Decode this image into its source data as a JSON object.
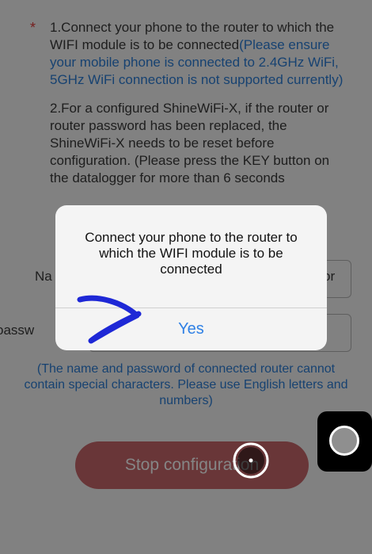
{
  "instructions": {
    "step1_asterisk": "*",
    "step1_text": "1.Connect your phone to the router to which the WIFI module is to be connected",
    "step1_note": "(Please ensure your mobile phone is connected to 2.4GHz WiFi, 5GHz WiFi connection is not supported currently)",
    "step2_text": "2.For a configured ShineWiFi-X, if the router or router password has been replaced, the ShineWiFi-X needs to be reset before configuration. (Please press the KEY button on the datalogger for more than 6 seconds"
  },
  "form": {
    "name_label": "Na",
    "name_suffix": "or",
    "password_label": "oassw"
  },
  "hint": "(The name and password of connected router cannot contain special characters. Please use English letters and numbers)",
  "stop_button_label": "Stop configuration",
  "dialog": {
    "message": "Connect your phone to the router to which the WIFI module is to be connected",
    "yes_label": "Yes"
  },
  "colors": {
    "accent": "#2c7fd9",
    "stop_button": "#c9686c",
    "asterisk": "#e23b3b",
    "annotation_scribble": "#1e28d6"
  },
  "icons": {
    "floating_assistive": "assistive-touch-icon",
    "touch": "touch-indicator-icon"
  }
}
